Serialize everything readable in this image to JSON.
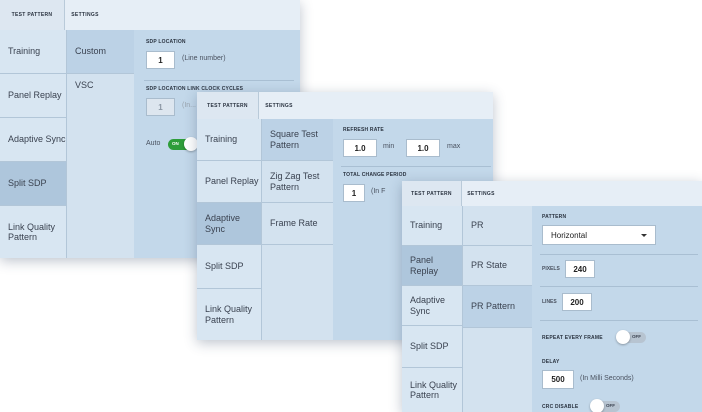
{
  "tabs": {
    "test_pattern": "TEST PATTERN",
    "settings": "SETTINGS"
  },
  "nav": {
    "training": "Training",
    "panel_replay": "Panel Replay",
    "adaptive_sync": "Adaptive Sync",
    "split_sdp": "Split SDP",
    "link_quality": "Link Quality Pattern"
  },
  "panel1": {
    "sub": {
      "custom": "Custom",
      "vsc": "VSC"
    },
    "sdp_location_label": "SDP LOCATION",
    "sdp_location_value": "1",
    "sdp_location_note": "(Line number)",
    "cycles_label": "SDP LOCATION LINK CLOCK CYCLES",
    "cycles_value": "1",
    "cycles_note": "(In...",
    "auto_label": "Auto",
    "auto_toggle": "ON"
  },
  "panel2": {
    "sub": {
      "square": "Square Test Pattern",
      "zigzag": "Zig Zag Test Pattern",
      "frame_rate": "Frame Rate"
    },
    "refresh_label": "REFRESH RATE",
    "min_value": "1.0",
    "min_label": "min",
    "max_value": "1.0",
    "max_label": "max",
    "change_label": "TOTAL CHANGE PERIOD",
    "change_value": "1",
    "change_note": "(In F"
  },
  "panel3": {
    "sub": {
      "pr": "PR",
      "pr_state": "PR State",
      "pr_pattern": "PR Pattern"
    },
    "pattern_label": "PATTERN",
    "pattern_value": "Horizontal",
    "pixels_label": "PIXELS",
    "pixels_value": "240",
    "lines_label": "LINES",
    "lines_value": "200",
    "repeat_label": "REPEAT EVERY FRAME",
    "repeat_toggle": "OFF",
    "delay_label": "DELAY",
    "delay_value": "500",
    "delay_note": "(In Milli Seconds)",
    "crc_label": "CRC DISABLE",
    "crc_toggle": "OFF"
  },
  "colors": {
    "toggle_on": "#2e9d3a",
    "toggle_off": "#b7c4d1"
  }
}
